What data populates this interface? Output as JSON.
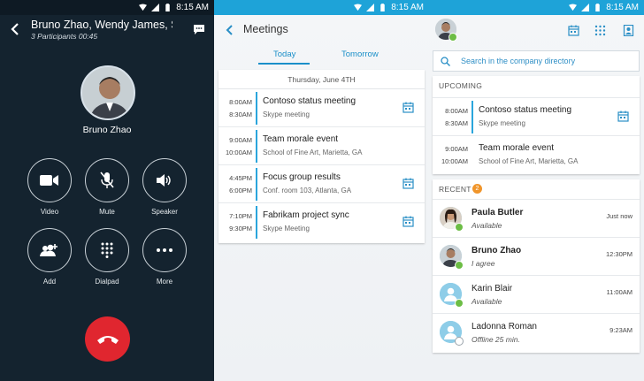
{
  "status": {
    "time": "8:15",
    "ampm": "AM"
  },
  "call": {
    "title": "Bruno Zhao, Wendy James, Ser ...",
    "subtitle": "3 Participants 00:45",
    "caller": "Bruno Zhao",
    "controls": [
      {
        "label": "Video",
        "icon": "video-icon"
      },
      {
        "label": "Mute",
        "icon": "mic-off-icon"
      },
      {
        "label": "Speaker",
        "icon": "speaker-icon"
      },
      {
        "label": "Add",
        "icon": "add-people-icon"
      },
      {
        "label": "Dialpad",
        "icon": "dialpad-icon"
      },
      {
        "label": "More",
        "icon": "more-icon"
      }
    ],
    "colors": {
      "bg": "#14232f",
      "hangup": "#e0262f"
    }
  },
  "meetings": {
    "title": "Meetings",
    "tabs": [
      "Today",
      "Tomorrow"
    ],
    "date": "Thursday, June 4TH",
    "items": [
      {
        "start": "8:00AM",
        "end": "8:30AM",
        "name": "Contoso status meeting",
        "location": "Skype meeting",
        "join": true
      },
      {
        "start": "9:00AM",
        "end": "10:00AM",
        "name": "Team morale event",
        "location": "School of Fine Art, Marietta, GA",
        "join": false
      },
      {
        "start": "4:45PM",
        "end": "6:00PM",
        "name": "Focus group results",
        "location": "Conf. room 103, Atlanta, GA",
        "join": true
      },
      {
        "start": "7:10PM",
        "end": "9:30PM",
        "name": "Fabrikam project sync",
        "location": "Skype Meeting",
        "join": true
      }
    ],
    "accent": "#2aa5dc"
  },
  "home": {
    "search_placeholder": "Search in the company directory",
    "upcoming_label": "UPCOMING",
    "upcoming": [
      {
        "start": "8:00AM",
        "end": "8:30AM",
        "name": "Contoso status meeting",
        "location": "Skype meeting"
      },
      {
        "start": "9:00AM",
        "end": "10:00AM",
        "name": "Team morale event",
        "location": "School of Fine Art, Marietta, GA"
      }
    ],
    "recent_label": "RECENT",
    "recent_count": "2",
    "recent": [
      {
        "name": "Paula Butler",
        "status": "Available",
        "time": "Just now",
        "bold": true,
        "presence": "available"
      },
      {
        "name": "Bruno Zhao",
        "status": "I agree",
        "time": "12:30PM",
        "bold": true,
        "presence": "available"
      },
      {
        "name": "Karin Blair",
        "status": "Available",
        "time": "11:00AM",
        "bold": false,
        "presence": "available"
      },
      {
        "name": "Ladonna Roman",
        "status": "Offline 25 min.",
        "time": "9:23AM",
        "bold": false,
        "presence": "offline"
      }
    ]
  }
}
